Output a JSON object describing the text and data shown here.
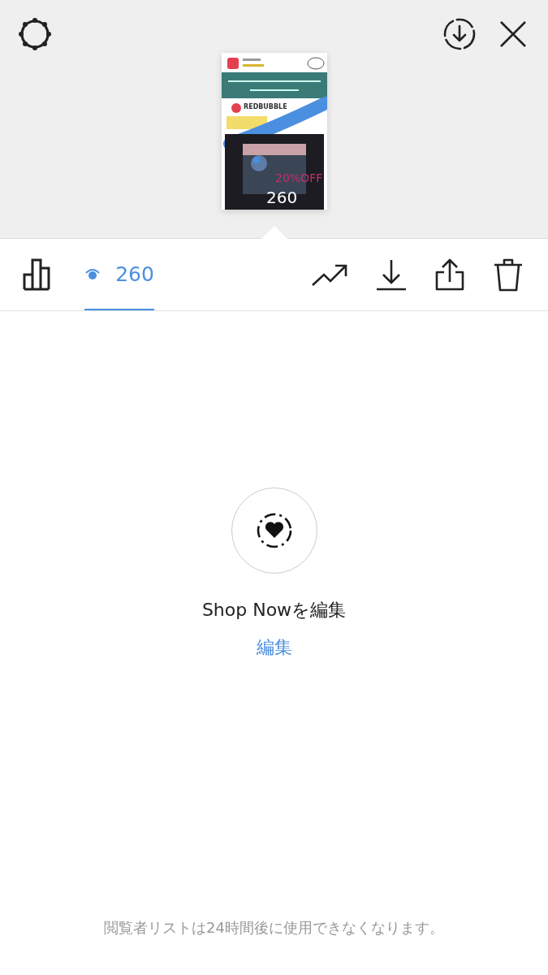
{
  "thumbnail": {
    "brand": "REDBUBBLE",
    "promo": "20%OFF",
    "view_count": "260"
  },
  "tabs": [
    {
      "kind": "insights",
      "selected": false
    },
    {
      "kind": "viewers",
      "label": "260",
      "selected": true
    }
  ],
  "empty_state": {
    "title": "Shop Nowを編集",
    "link": "編集"
  },
  "footer_note": "閲覧者リストは24時間後に使用できなくなります。"
}
